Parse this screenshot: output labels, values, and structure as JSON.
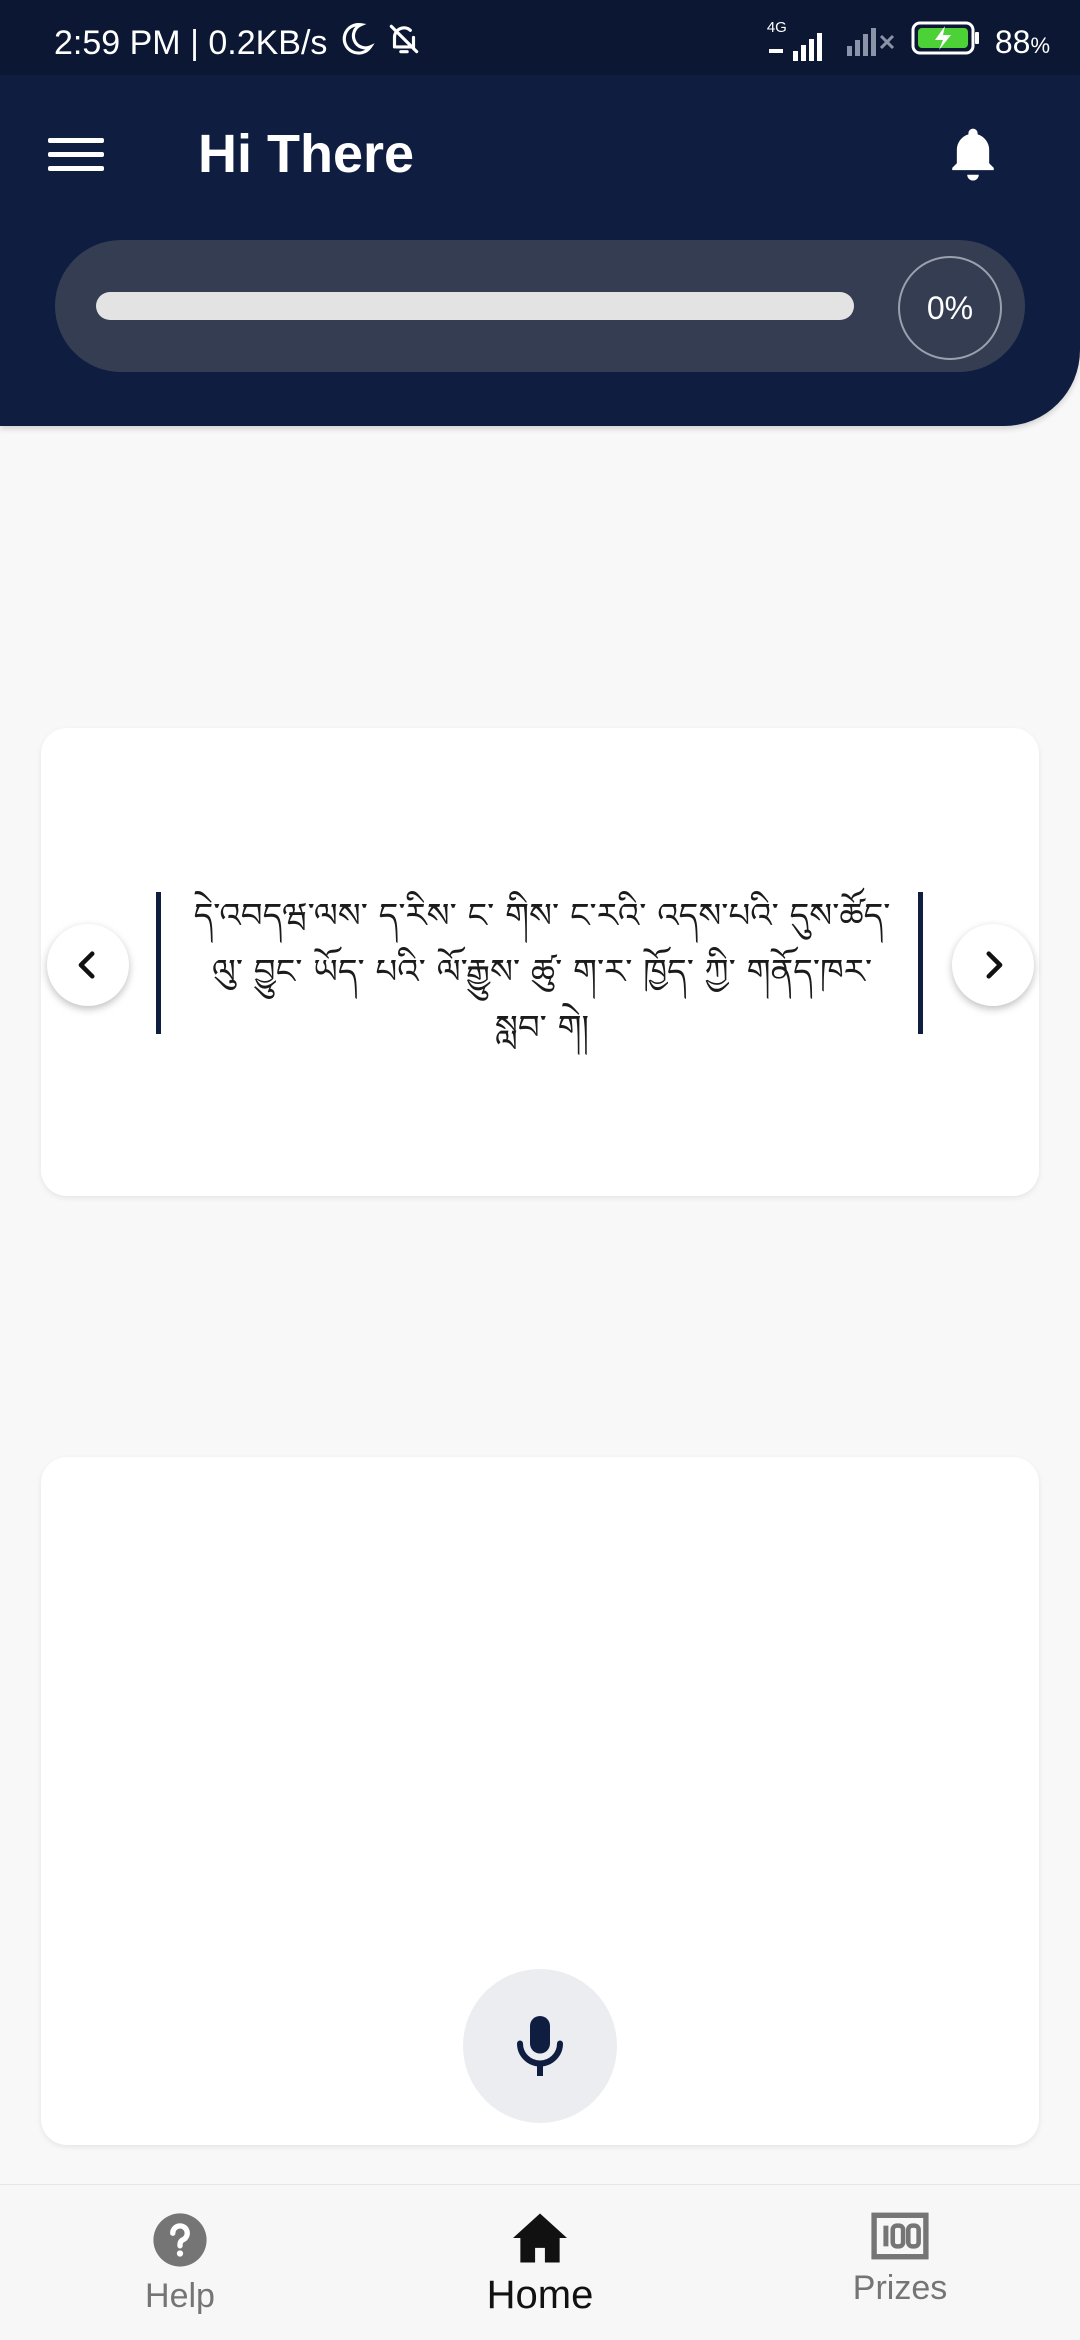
{
  "status_bar": {
    "time_speed": "2:59 PM | 0.2KB/s",
    "network_label": "4G",
    "battery": "88"
  },
  "app_bar": {
    "title": "Hi There"
  },
  "progress": {
    "value": 0,
    "label": "0%"
  },
  "sentence": {
    "text": "དེ་འབདཝ་ལས་ ད་རིས་ ང་ གིས་ ང་རའི་ འདས་པའི་ དུས་ཚོད་ ལུ་ བྱུང་ ཡོད་ པའི་ ལོ་རྒྱུས་ ཚུ་ ག་ར་ ཁྱོད་ ཀྱི་ གནོད་ཁར་ སླབ་ གེ།"
  },
  "bottom_nav": {
    "items": [
      {
        "label": "Help"
      },
      {
        "label": "Home"
      },
      {
        "label": "Prizes"
      }
    ],
    "active": "Home"
  },
  "colors": {
    "header": "#0f1d40",
    "panel": "#353d52",
    "accent": "#0f1d40"
  },
  "icons": [
    "menu-icon",
    "bell-icon",
    "chevron-left-icon",
    "chevron-right-icon",
    "microphone-icon",
    "help-circle-icon",
    "home-icon",
    "prizes-icon"
  ]
}
